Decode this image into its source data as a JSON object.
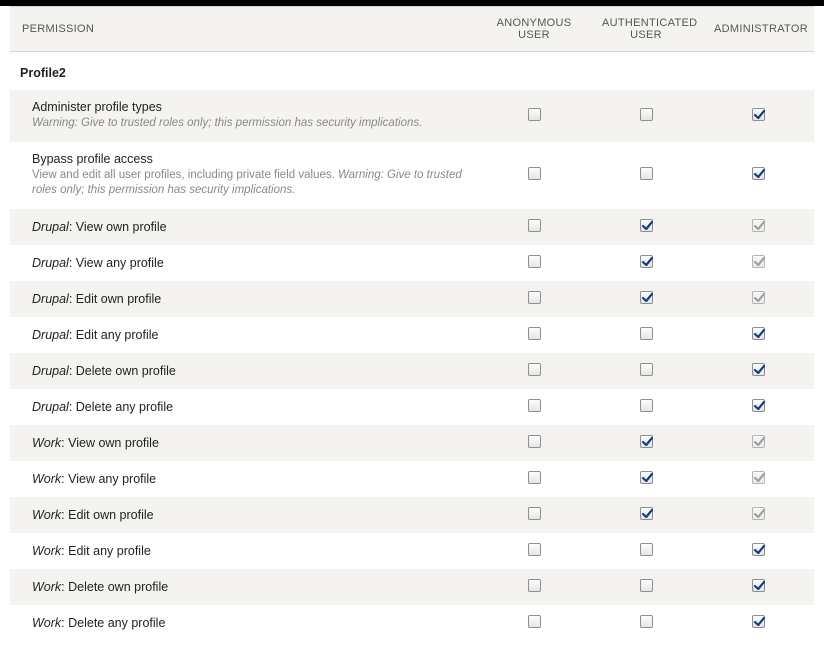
{
  "columns": {
    "permission": "PERMISSION",
    "roles": [
      "ANONYMOUS USER",
      "AUTHENTICATED USER",
      "ADMINISTRATOR"
    ]
  },
  "section": {
    "label": "Profile2"
  },
  "rows": [
    {
      "label_plain": "Administer profile types",
      "desc_prefix_italic": "Warning: Give to trusted roles only; this permission has security implications.",
      "desc_plain": "",
      "desc_suffix_italic": "",
      "cells": [
        {
          "checked": false,
          "disabled": false
        },
        {
          "checked": false,
          "disabled": false
        },
        {
          "checked": true,
          "disabled": false
        }
      ]
    },
    {
      "label_plain": "Bypass profile access",
      "desc_prefix_italic": "",
      "desc_plain": "View and edit all user profiles, including private field values. ",
      "desc_suffix_italic": "Warning: Give to trusted roles only; this permission has security implications.",
      "cells": [
        {
          "checked": false,
          "disabled": false
        },
        {
          "checked": false,
          "disabled": false
        },
        {
          "checked": true,
          "disabled": false
        }
      ]
    },
    {
      "label_em": "Drupal",
      "label_plain": ": View own profile",
      "cells": [
        {
          "checked": false,
          "disabled": false
        },
        {
          "checked": true,
          "disabled": false
        },
        {
          "checked": true,
          "disabled": true
        }
      ]
    },
    {
      "label_em": "Drupal",
      "label_plain": ": View any profile",
      "cells": [
        {
          "checked": false,
          "disabled": false
        },
        {
          "checked": true,
          "disabled": false
        },
        {
          "checked": true,
          "disabled": true
        }
      ]
    },
    {
      "label_em": "Drupal",
      "label_plain": ": Edit own profile",
      "cells": [
        {
          "checked": false,
          "disabled": false
        },
        {
          "checked": true,
          "disabled": false
        },
        {
          "checked": true,
          "disabled": true
        }
      ]
    },
    {
      "label_em": "Drupal",
      "label_plain": ": Edit any profile",
      "cells": [
        {
          "checked": false,
          "disabled": false
        },
        {
          "checked": false,
          "disabled": false
        },
        {
          "checked": true,
          "disabled": false
        }
      ]
    },
    {
      "label_em": "Drupal",
      "label_plain": ": Delete own profile",
      "cells": [
        {
          "checked": false,
          "disabled": false
        },
        {
          "checked": false,
          "disabled": false
        },
        {
          "checked": true,
          "disabled": false
        }
      ]
    },
    {
      "label_em": "Drupal",
      "label_plain": ": Delete any profile",
      "cells": [
        {
          "checked": false,
          "disabled": false
        },
        {
          "checked": false,
          "disabled": false
        },
        {
          "checked": true,
          "disabled": false
        }
      ]
    },
    {
      "label_em": "Work",
      "label_plain": ": View own profile",
      "cells": [
        {
          "checked": false,
          "disabled": false
        },
        {
          "checked": true,
          "disabled": false
        },
        {
          "checked": true,
          "disabled": true
        }
      ]
    },
    {
      "label_em": "Work",
      "label_plain": ": View any profile",
      "cells": [
        {
          "checked": false,
          "disabled": false
        },
        {
          "checked": true,
          "disabled": false
        },
        {
          "checked": true,
          "disabled": true
        }
      ]
    },
    {
      "label_em": "Work",
      "label_plain": ": Edit own profile",
      "cells": [
        {
          "checked": false,
          "disabled": false
        },
        {
          "checked": true,
          "disabled": false
        },
        {
          "checked": true,
          "disabled": true
        }
      ]
    },
    {
      "label_em": "Work",
      "label_plain": ": Edit any profile",
      "cells": [
        {
          "checked": false,
          "disabled": false
        },
        {
          "checked": false,
          "disabled": false
        },
        {
          "checked": true,
          "disabled": false
        }
      ]
    },
    {
      "label_em": "Work",
      "label_plain": ": Delete own profile",
      "cells": [
        {
          "checked": false,
          "disabled": false
        },
        {
          "checked": false,
          "disabled": false
        },
        {
          "checked": true,
          "disabled": false
        }
      ]
    },
    {
      "label_em": "Work",
      "label_plain": ": Delete any profile",
      "cells": [
        {
          "checked": false,
          "disabled": false
        },
        {
          "checked": false,
          "disabled": false
        },
        {
          "checked": true,
          "disabled": false
        }
      ]
    }
  ]
}
